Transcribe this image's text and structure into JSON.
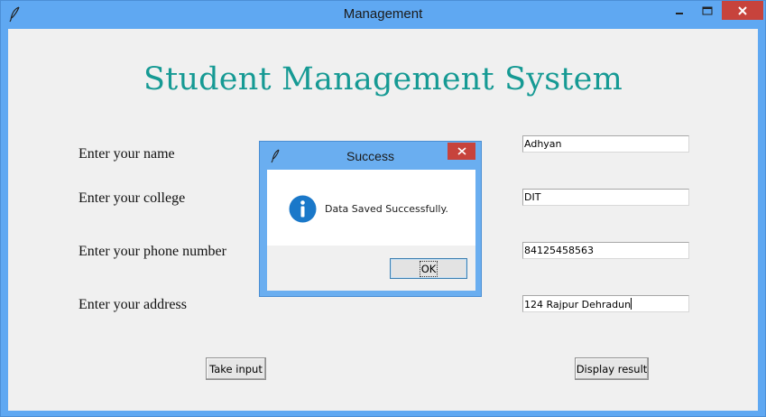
{
  "window": {
    "title": "Management"
  },
  "heading": "Student Management System",
  "form": {
    "fields": [
      {
        "label": "Enter your name",
        "value": "Adhyan"
      },
      {
        "label": "Enter your college",
        "value": "DIT"
      },
      {
        "label": "Enter your phone number",
        "value": "84125458563"
      },
      {
        "label": "Enter your address",
        "value": "124 Rajpur Dehradun"
      }
    ]
  },
  "buttons": {
    "take_input": "Take input",
    "display_result": "Display result"
  },
  "dialog": {
    "title": "Success",
    "message": "Data Saved Successfully.",
    "ok_label": "OK",
    "icon": "info-icon"
  },
  "colors": {
    "heading": "#169a94",
    "titlebar": "#5fa8f2",
    "close": "#c7433c",
    "info_icon": "#1a78c9"
  },
  "icons": {
    "app": "feather-icon",
    "minimize": "minimize-icon",
    "maximize": "maximize-icon",
    "close": "close-icon"
  }
}
